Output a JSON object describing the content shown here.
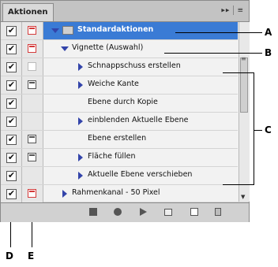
{
  "panel": {
    "tab_label": "Aktionen",
    "menu_glyph": "▸▸",
    "menu_lines": "≡"
  },
  "rows": [
    {
      "label": "Standardaktionen",
      "level": 0,
      "expand": "down",
      "icon": "folder",
      "checked": "✔",
      "dialog": "red",
      "selected": true
    },
    {
      "label": "Vignette (Auswahl)",
      "level": 1,
      "expand": "down",
      "icon": "",
      "checked": "✔",
      "dialog": "red",
      "selected": false
    },
    {
      "label": "Schnappschuss erstellen",
      "level": 2,
      "expand": "right",
      "icon": "",
      "checked": "✔",
      "dialog": "faint",
      "selected": false
    },
    {
      "label": "Weiche Kante",
      "level": 2,
      "expand": "right",
      "icon": "",
      "checked": "✔",
      "dialog": "normal",
      "selected": false
    },
    {
      "label": "Ebene durch Kopie",
      "level": 2,
      "expand": "none",
      "icon": "",
      "checked": "✔",
      "dialog": "none",
      "selected": false
    },
    {
      "label": "einblenden Aktuelle Ebene",
      "level": 2,
      "expand": "right",
      "icon": "",
      "checked": "✔",
      "dialog": "none",
      "selected": false
    },
    {
      "label": "Ebene erstellen",
      "level": 2,
      "expand": "none",
      "icon": "",
      "checked": "✔",
      "dialog": "normal",
      "selected": false
    },
    {
      "label": "Fläche füllen",
      "level": 2,
      "expand": "right",
      "icon": "",
      "checked": "✔",
      "dialog": "normal",
      "selected": false
    },
    {
      "label": "Aktuelle Ebene verschieben",
      "level": 2,
      "expand": "right",
      "icon": "",
      "checked": "✔",
      "dialog": "none",
      "selected": false
    },
    {
      "label": "Rahmenkanal - 50 Pixel",
      "level": 1,
      "expand": "right",
      "icon": "",
      "checked": "✔",
      "dialog": "red",
      "selected": false
    }
  ],
  "toolbar": {
    "icons": [
      "stop-icon",
      "record-icon",
      "play-icon",
      "new-set-icon",
      "new-action-icon",
      "trash-icon"
    ]
  },
  "callouts": {
    "a": "A",
    "b": "B",
    "c": "C",
    "d": "D",
    "e": "E"
  },
  "colors": {
    "selection": "#3a7bd5",
    "dialog_red": "#d43a3a",
    "expand_arrow": "#3344aa"
  }
}
